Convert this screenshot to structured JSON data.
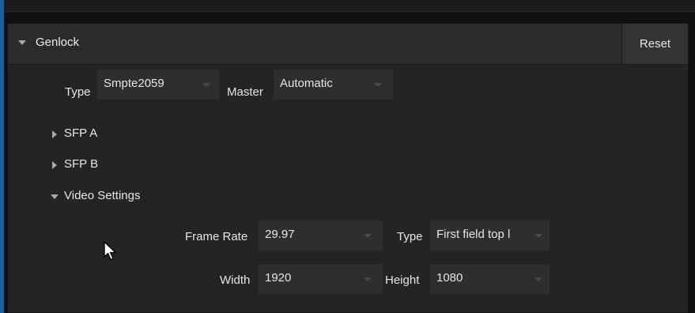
{
  "section": {
    "title": "Genlock",
    "reset_label": "Reset"
  },
  "genlock": {
    "type_label": "Type",
    "type_value": "Smpte2059",
    "master_label": "Master",
    "master_value": "Automatic"
  },
  "tree": {
    "sfp_a": "SFP A",
    "sfp_b": "SFP B",
    "video_settings": "Video Settings"
  },
  "video_settings": {
    "frame_rate_label": "Frame Rate",
    "frame_rate_value": "29.97",
    "type_label": "Type",
    "type_value": "First field top l",
    "width_label": "Width",
    "width_value": "1920",
    "height_label": "Height",
    "height_value": "1080"
  },
  "colors": {
    "panel_bg": "#242424",
    "header_bg": "#2b2b2b",
    "dropdown_bg": "#2e2e2e",
    "accent": "#1f5e9c"
  },
  "icons": {
    "collapse": "chevron-down-icon",
    "expand": "chevron-right-icon",
    "pointer": "mouse-cursor-icon"
  }
}
